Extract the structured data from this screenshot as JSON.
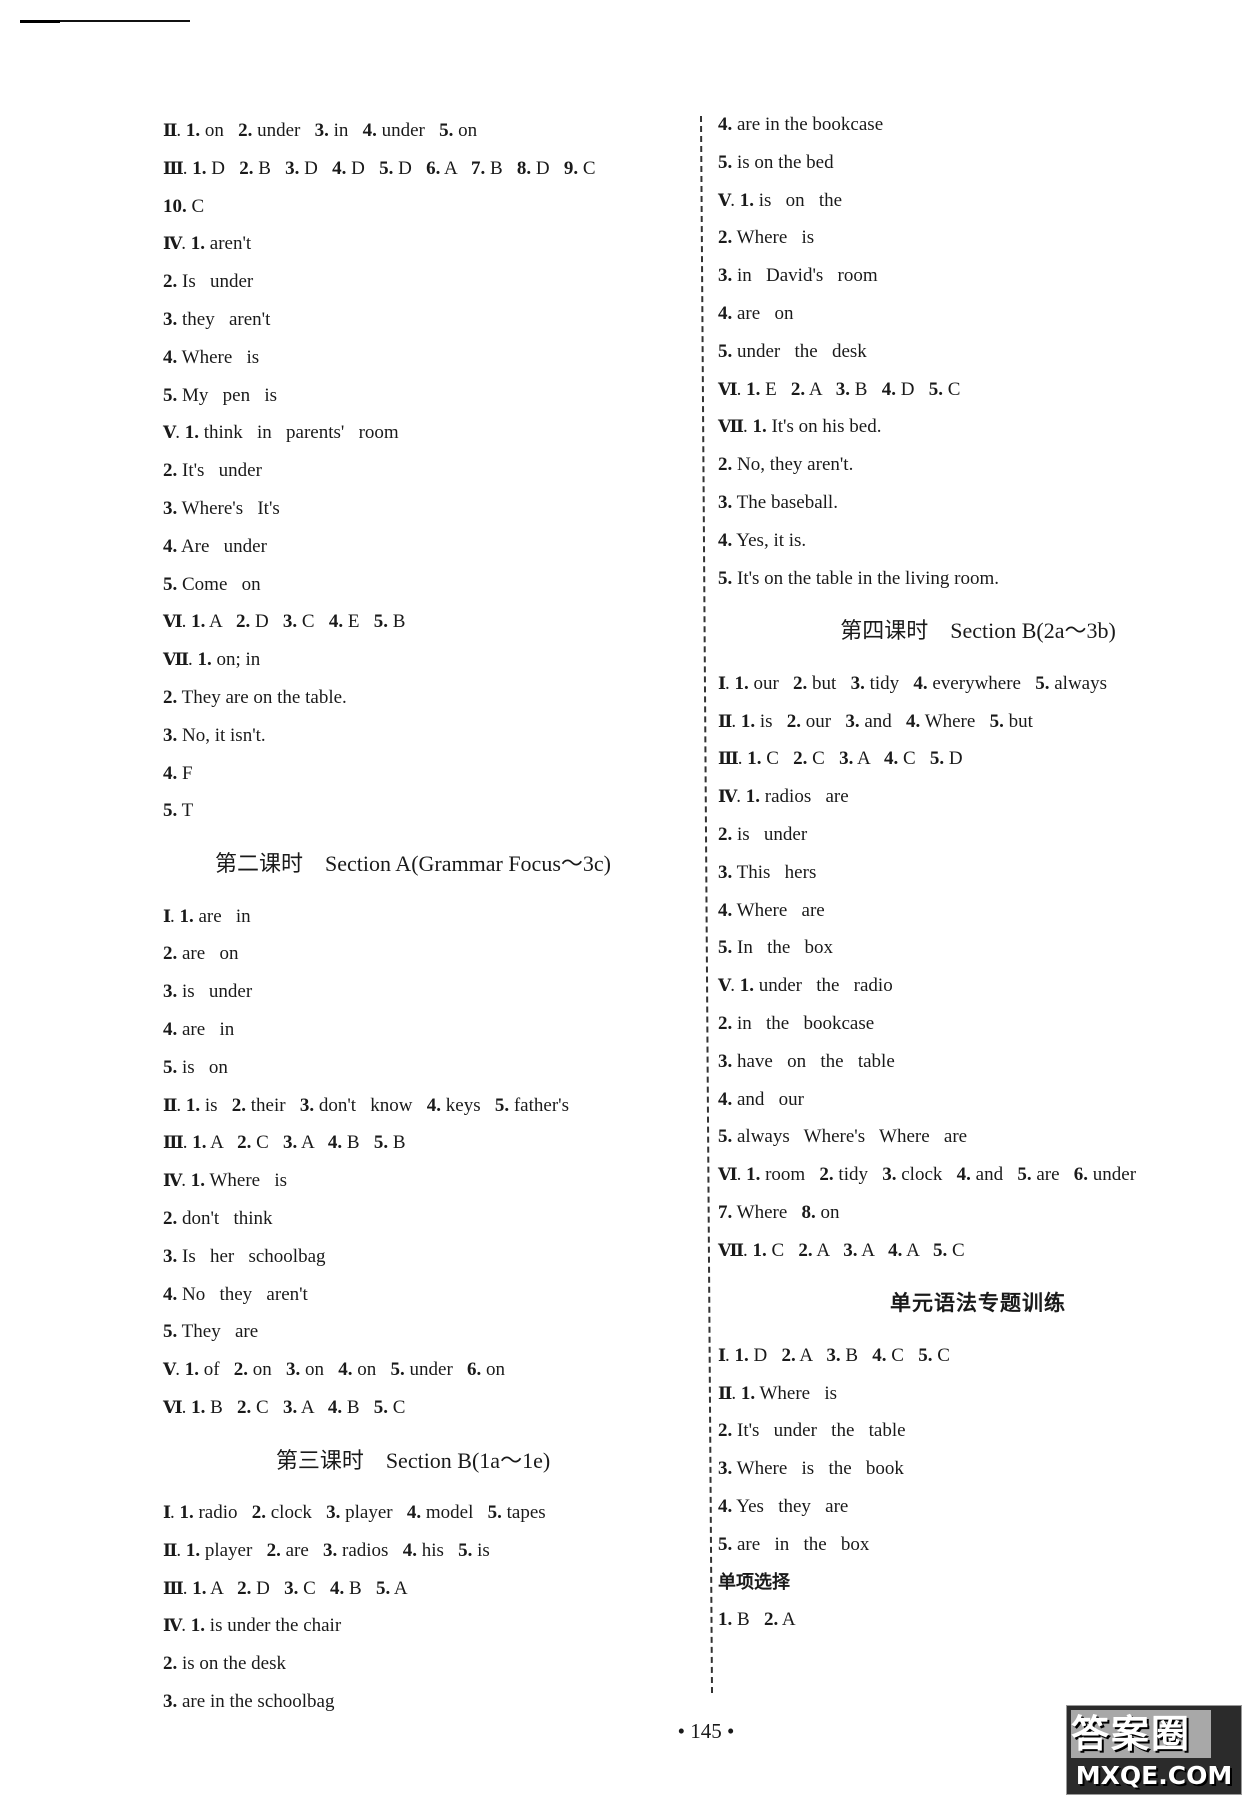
{
  "page_number": "145",
  "left_column": [
    {
      "type": "row",
      "text": "Ⅱ. 1. on   2. under   3. in   4. under   5. on"
    },
    {
      "type": "row",
      "text": "Ⅲ. 1. D   2. B   3. D   4. D   5. D   6. A   7. B   8. D   9. C"
    },
    {
      "type": "row",
      "text": "10. C"
    },
    {
      "type": "row",
      "text": "Ⅳ. 1. aren't"
    },
    {
      "type": "row",
      "text": "2. Is   under"
    },
    {
      "type": "row",
      "text": "3. they   aren't"
    },
    {
      "type": "row",
      "text": "4. Where   is"
    },
    {
      "type": "row",
      "text": "5. My   pen   is"
    },
    {
      "type": "row",
      "text": "Ⅴ. 1. think   in   parents'   room"
    },
    {
      "type": "row",
      "text": "2. It's   under"
    },
    {
      "type": "row",
      "text": "3. Where's   It's"
    },
    {
      "type": "row",
      "text": "4. Are   under"
    },
    {
      "type": "row",
      "text": "5. Come   on"
    },
    {
      "type": "row",
      "text": "Ⅵ. 1. A   2. D   3. C   4. E   5. B"
    },
    {
      "type": "row",
      "text": "Ⅶ. 1. on; in"
    },
    {
      "type": "row",
      "text": "2. They are on the table."
    },
    {
      "type": "row",
      "text": "3. No, it isn't."
    },
    {
      "type": "row",
      "text": "4. F"
    },
    {
      "type": "row",
      "text": "5. T"
    },
    {
      "type": "heading",
      "text": "第二课时    Section A(Grammar Focus～3c)"
    },
    {
      "type": "row",
      "text": "Ⅰ. 1. are   in"
    },
    {
      "type": "row",
      "text": "2. are   on"
    },
    {
      "type": "row",
      "text": "3. is   under"
    },
    {
      "type": "row",
      "text": "4. are   in"
    },
    {
      "type": "row",
      "text": "5. is   on"
    },
    {
      "type": "row",
      "text": "Ⅱ. 1. is   2. their   3. don't   know   4. keys   5. father's"
    },
    {
      "type": "row",
      "text": "Ⅲ. 1. A   2. C   3. A   4. B   5. B"
    },
    {
      "type": "row",
      "text": "Ⅳ. 1. Where   is"
    },
    {
      "type": "row",
      "text": "2. don't   think"
    },
    {
      "type": "row",
      "text": "3. Is   her   schoolbag"
    },
    {
      "type": "row",
      "text": "4. No   they   aren't"
    },
    {
      "type": "row",
      "text": "5. They   are"
    },
    {
      "type": "row",
      "text": "Ⅴ. 1. of   2. on   3. on   4. on   5. under   6. on"
    },
    {
      "type": "row",
      "text": "Ⅵ. 1. B   2. C   3. A   4. B   5. C"
    },
    {
      "type": "heading",
      "text": "第三课时    Section B(1a～1e)"
    },
    {
      "type": "row",
      "text": "Ⅰ. 1. radio   2. clock   3. player   4. model   5. tapes"
    },
    {
      "type": "row",
      "text": "Ⅱ. 1. player   2. are   3. radios   4. his   5. is"
    },
    {
      "type": "row",
      "text": "Ⅲ. 1. A   2. D   3. C   4. B   5. A"
    },
    {
      "type": "row",
      "text": "Ⅳ. 1. is under the chair"
    },
    {
      "type": "row",
      "text": "2. is on the desk"
    },
    {
      "type": "row",
      "text": "3. are in the schoolbag"
    }
  ],
  "right_column": [
    {
      "type": "row",
      "text": "4. are in the bookcase"
    },
    {
      "type": "row",
      "text": "5. is on the bed"
    },
    {
      "type": "row",
      "text": "Ⅴ. 1. is   on   the"
    },
    {
      "type": "row",
      "text": "2. Where   is"
    },
    {
      "type": "row",
      "text": "3. in   David's   room"
    },
    {
      "type": "row",
      "text": "4. are   on"
    },
    {
      "type": "row",
      "text": "5. under   the   desk"
    },
    {
      "type": "row",
      "text": "Ⅵ. 1. E   2. A   3. B   4. D   5. C"
    },
    {
      "type": "row",
      "text": "Ⅶ. 1. It's on his bed."
    },
    {
      "type": "row",
      "text": "2. No, they aren't."
    },
    {
      "type": "row",
      "text": "3. The baseball."
    },
    {
      "type": "row",
      "text": "4. Yes, it is."
    },
    {
      "type": "row",
      "text": "5. It's on the table in the living room."
    },
    {
      "type": "heading",
      "text": "第四课时    Section B(2a～3b)"
    },
    {
      "type": "row",
      "text": "Ⅰ. 1. our   2. but   3. tidy   4. everywhere   5. always"
    },
    {
      "type": "row",
      "text": "Ⅱ. 1. is   2. our   3. and   4. Where   5. but"
    },
    {
      "type": "row",
      "text": "Ⅲ. 1. C   2. C   3. A   4. C   5. D"
    },
    {
      "type": "row",
      "text": "Ⅳ. 1. radios   are"
    },
    {
      "type": "row",
      "text": "2. is   under"
    },
    {
      "type": "row",
      "text": "3. This   hers"
    },
    {
      "type": "row",
      "text": "4. Where   are"
    },
    {
      "type": "row",
      "text": "5. In   the   box"
    },
    {
      "type": "row",
      "text": "Ⅴ. 1. under   the   radio"
    },
    {
      "type": "row",
      "text": "2. in   the   bookcase"
    },
    {
      "type": "row",
      "text": "3. have   on   the   table"
    },
    {
      "type": "row",
      "text": "4. and   our"
    },
    {
      "type": "row",
      "text": "5. always   Where's   Where   are"
    },
    {
      "type": "row",
      "text": "Ⅵ. 1. room   2. tidy   3. clock   4. and   5. are   6. under"
    },
    {
      "type": "row",
      "text": "7. Where   8. on"
    },
    {
      "type": "row",
      "text": "Ⅶ. 1. C   2. A   3. A   4. A   5. C"
    },
    {
      "type": "heading-plain",
      "text": "单元语法专题训练"
    },
    {
      "type": "row",
      "text": "Ⅰ. 1. D   2. A   3. B   4. C   5. C"
    },
    {
      "type": "row",
      "text": "Ⅱ. 1. Where   is"
    },
    {
      "type": "row",
      "text": "2. It's   under   the   table"
    },
    {
      "type": "row",
      "text": "3. Where   is   the   book"
    },
    {
      "type": "row",
      "text": "4. Yes   they   are"
    },
    {
      "type": "row",
      "text": "5. are   in   the   box"
    },
    {
      "type": "subhead",
      "text": "单项选择"
    },
    {
      "type": "row",
      "text": "1. B   2. A"
    }
  ],
  "watermark": {
    "top_text": "答案圈",
    "bottom_text": "MXQE.COM"
  }
}
